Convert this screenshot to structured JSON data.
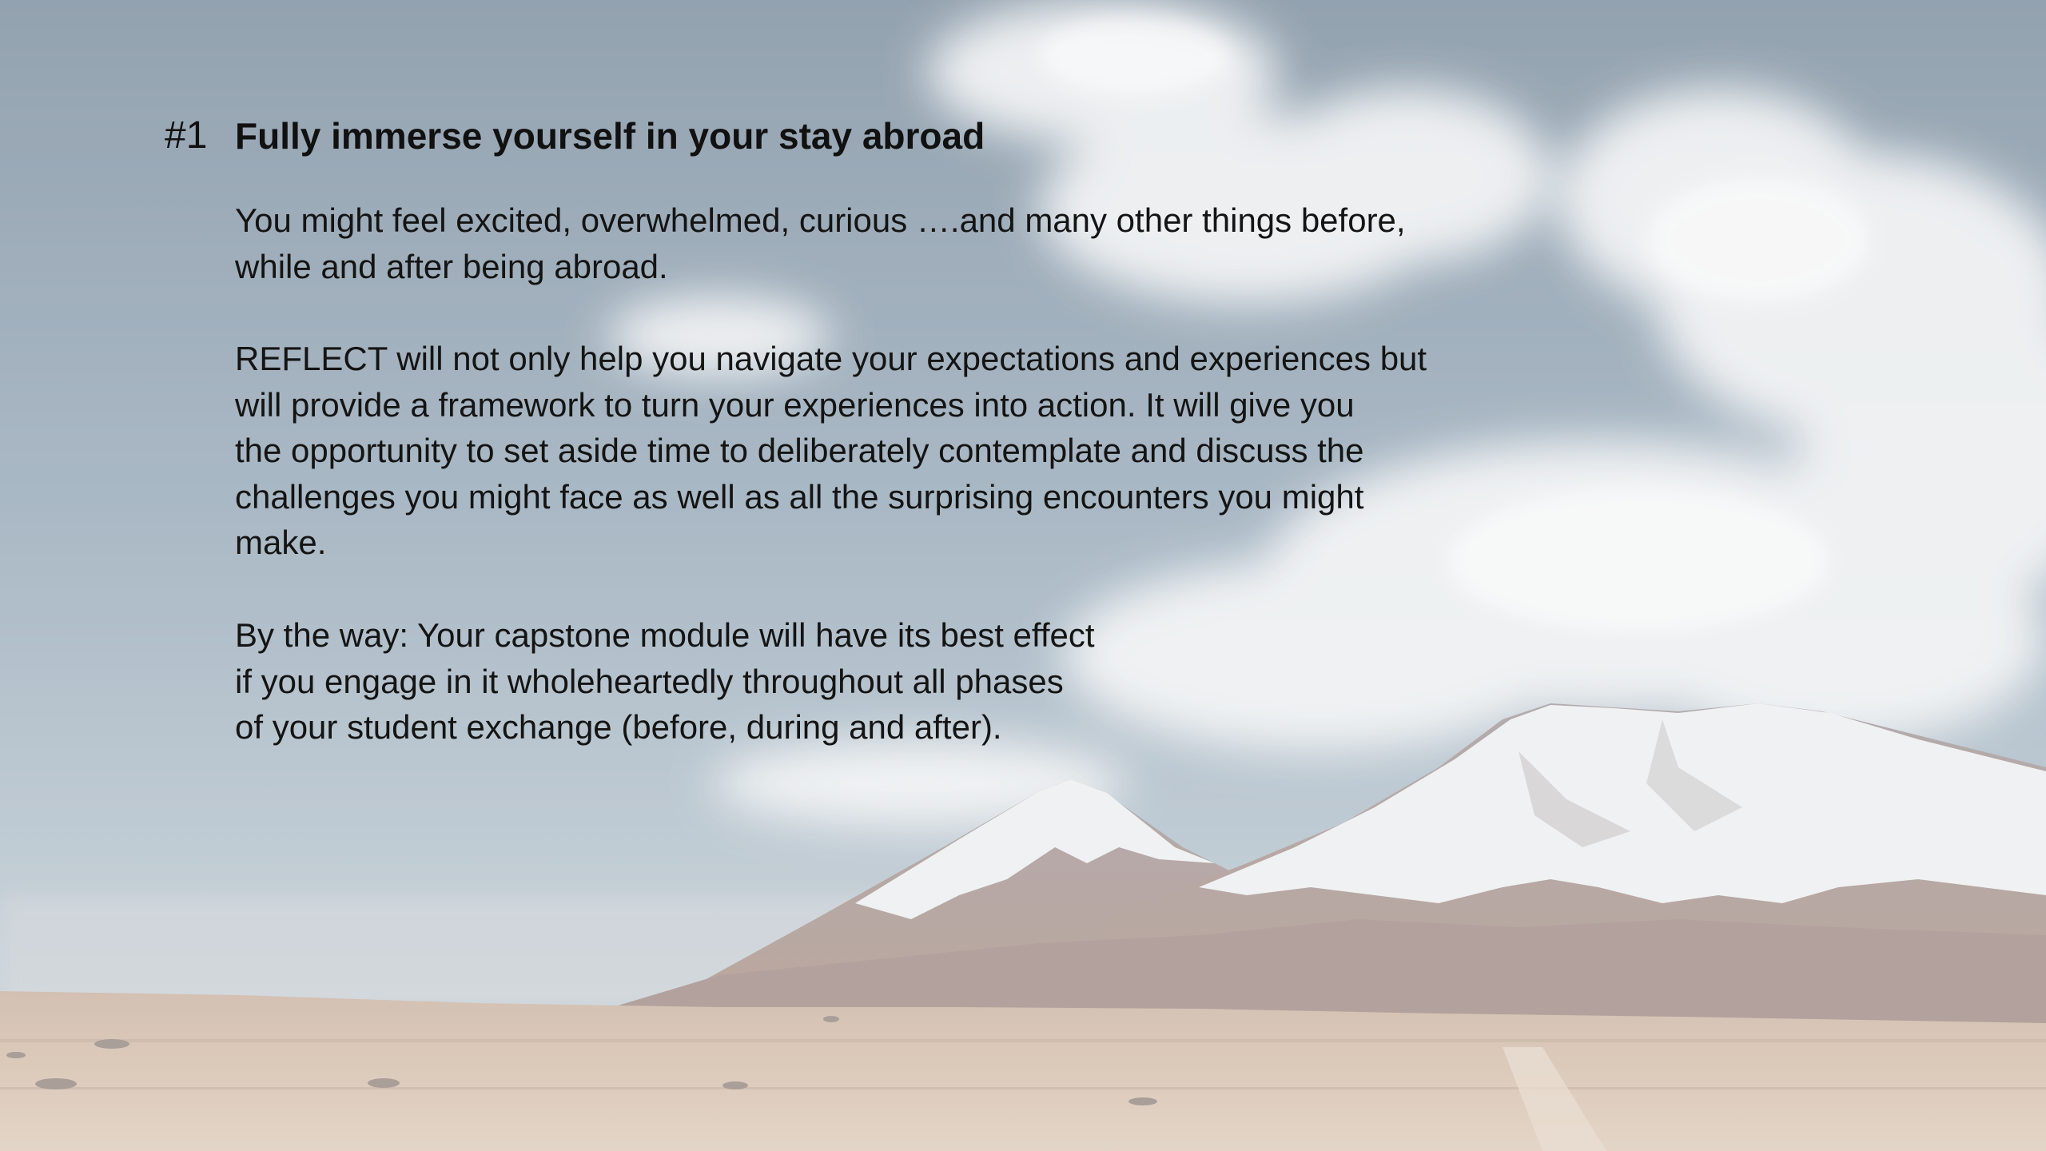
{
  "slide": {
    "number": "#1",
    "title": "Fully immerse yourself in your stay abroad",
    "paragraphs": [
      {
        "lines": [
          "You might feel excited, overwhelmed, curious ….and many other things before,",
          "while and after being abroad."
        ]
      },
      {
        "lines": [
          "REFLECT will not only help you navigate your expectations and experiences but",
          "will provide a framework to turn your experiences into action. It will give you",
          "the opportunity to set aside time to deliberately contemplate and discuss the",
          "challenges you might face as well as all the surprising encounters you might",
          "make."
        ]
      },
      {
        "lines": [
          "By the way: Your capstone module will have its best effect",
          "if you engage in it wholeheartedly throughout all phases",
          "of your student exchange (before, during and after)."
        ]
      }
    ]
  },
  "background": {
    "image": "mountain-desert-landscape",
    "colors": {
      "sky_top": "#8799a8",
      "sky_bottom": "#b8c6d0",
      "cloud": "#f2f3f3",
      "snow": "#eef0f1",
      "mountain_rock": "#9c8f8c",
      "desert": "#d6c2b0"
    }
  }
}
